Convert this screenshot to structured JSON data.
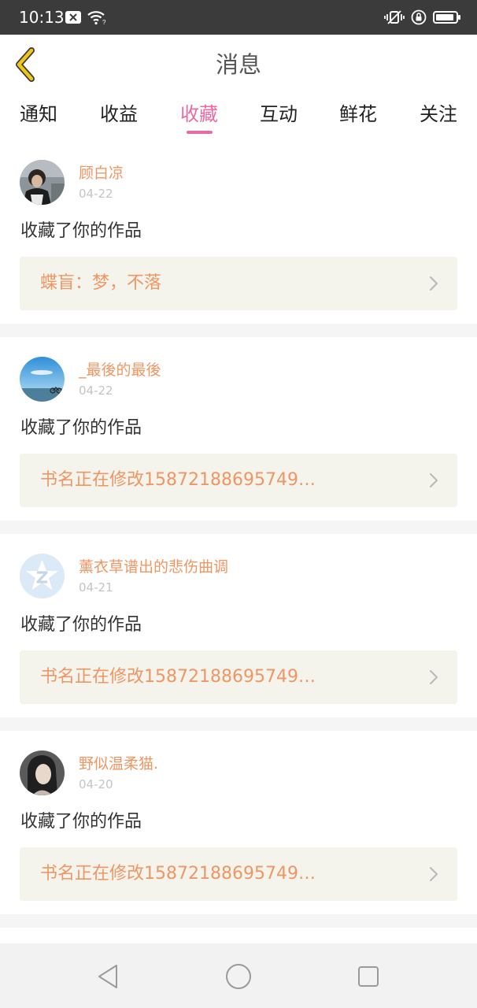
{
  "status_bar": {
    "time": "10:13",
    "left_icons": [
      "close-box-icon",
      "wifi-question-icon"
    ],
    "right_icons": [
      "vibrate-icon",
      "lock-rotation-icon",
      "battery-icon"
    ]
  },
  "header": {
    "title": "消息",
    "back_icon": "chevron-left-icon",
    "accent_color": "#f0c419"
  },
  "tabs": [
    {
      "label": "通知"
    },
    {
      "label": "收益"
    },
    {
      "label": "收藏"
    },
    {
      "label": "互动"
    },
    {
      "label": "鲜花"
    },
    {
      "label": "关注"
    }
  ],
  "active_tab_color": "#ec6aa3",
  "feed": [
    {
      "username": "顾白凉",
      "date": "04-22",
      "action": "收藏了你的作品",
      "work_title": "蝶盲：梦，不落",
      "avatar": "photo-boy"
    },
    {
      "username": "_最後的最後",
      "date": "04-22",
      "action": "收藏了你的作品",
      "work_title": "书名正在修改15872188695749…",
      "avatar": "photo-sky"
    },
    {
      "username": "薰衣草谱出的悲伤曲调",
      "date": "04-21",
      "action": "收藏了你的作品",
      "work_title": "书名正在修改15872188695749…",
      "avatar": "default-qzone-star"
    },
    {
      "username": "野似温柔猫.",
      "date": "04-20",
      "action": "收藏了你的作品",
      "work_title": "书名正在修改15872188695749…",
      "avatar": "photo-girl"
    }
  ],
  "colors": {
    "username": "#ef9663",
    "work_title": "#ef9663",
    "work_box_bg": "#f4f4ed"
  },
  "nav_bar": {
    "icons": [
      "back-triangle-icon",
      "home-circle-icon",
      "recents-square-icon"
    ]
  }
}
